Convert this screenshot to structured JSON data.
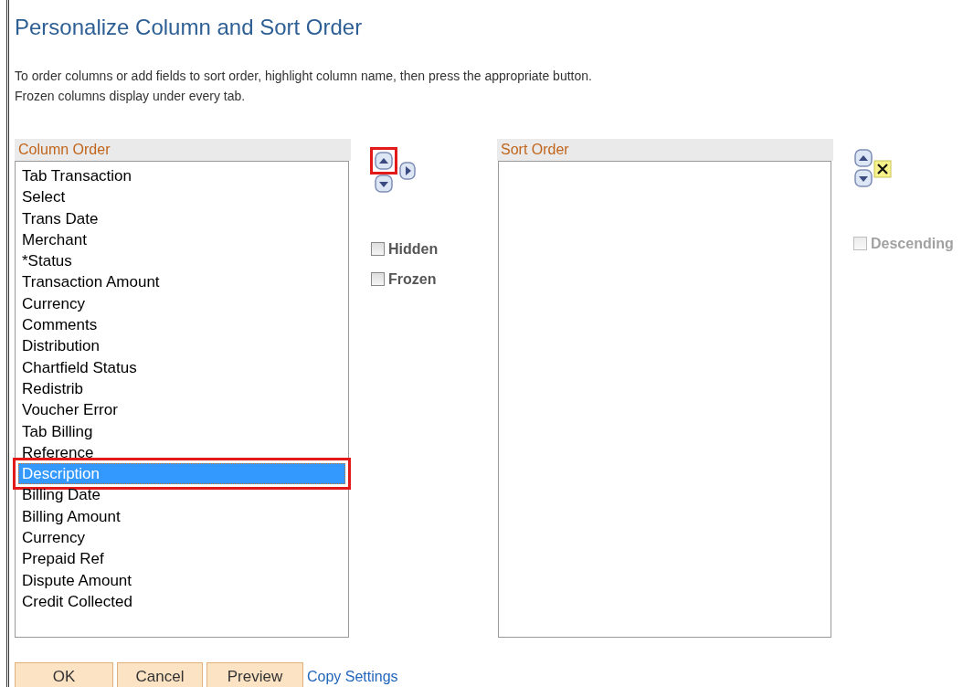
{
  "title": "Personalize Column and Sort Order",
  "instructions": [
    "To order columns or add fields to sort order, highlight column name, then press the appropriate button.",
    "Frozen columns display under every tab."
  ],
  "column_order": {
    "header": "Column Order",
    "items": [
      {
        "label": "Tab Transaction",
        "selected": false,
        "highlighted": false
      },
      {
        "label": "Select",
        "selected": false,
        "highlighted": false
      },
      {
        "label": "Trans Date",
        "selected": false,
        "highlighted": false
      },
      {
        "label": "Merchant",
        "selected": false,
        "highlighted": false
      },
      {
        "label": "*Status",
        "selected": false,
        "highlighted": false
      },
      {
        "label": "Transaction Amount",
        "selected": false,
        "highlighted": false
      },
      {
        "label": "Currency",
        "selected": false,
        "highlighted": false
      },
      {
        "label": "Comments",
        "selected": false,
        "highlighted": false
      },
      {
        "label": "Distribution",
        "selected": false,
        "highlighted": false
      },
      {
        "label": "Chartfield Status",
        "selected": false,
        "highlighted": false
      },
      {
        "label": "Redistrib",
        "selected": false,
        "highlighted": false
      },
      {
        "label": "Voucher Error",
        "selected": false,
        "highlighted": false
      },
      {
        "label": "Tab Billing",
        "selected": false,
        "highlighted": false
      },
      {
        "label": "Reference",
        "selected": false,
        "highlighted": false
      },
      {
        "label": "Description",
        "selected": true,
        "highlighted": true
      },
      {
        "label": "Billing Date",
        "selected": false,
        "highlighted": false
      },
      {
        "label": "Billing Amount",
        "selected": false,
        "highlighted": false
      },
      {
        "label": "Currency",
        "selected": false,
        "highlighted": false
      },
      {
        "label": "Prepaid Ref",
        "selected": false,
        "highlighted": false
      },
      {
        "label": "Dispute Amount",
        "selected": false,
        "highlighted": false
      },
      {
        "label": "Credit Collected",
        "selected": false,
        "highlighted": false
      }
    ]
  },
  "column_controls": {
    "move_up_highlighted": true,
    "checkboxes": [
      {
        "label": "Hidden",
        "checked": false
      },
      {
        "label": "Frozen",
        "checked": false
      }
    ]
  },
  "sort_order": {
    "header": "Sort Order"
  },
  "sort_controls": {
    "checkboxes": [
      {
        "label": "Descending",
        "checked": false,
        "disabled": true
      }
    ]
  },
  "buttons": [
    "OK",
    "Cancel",
    "Preview"
  ],
  "link": "Copy Settings"
}
